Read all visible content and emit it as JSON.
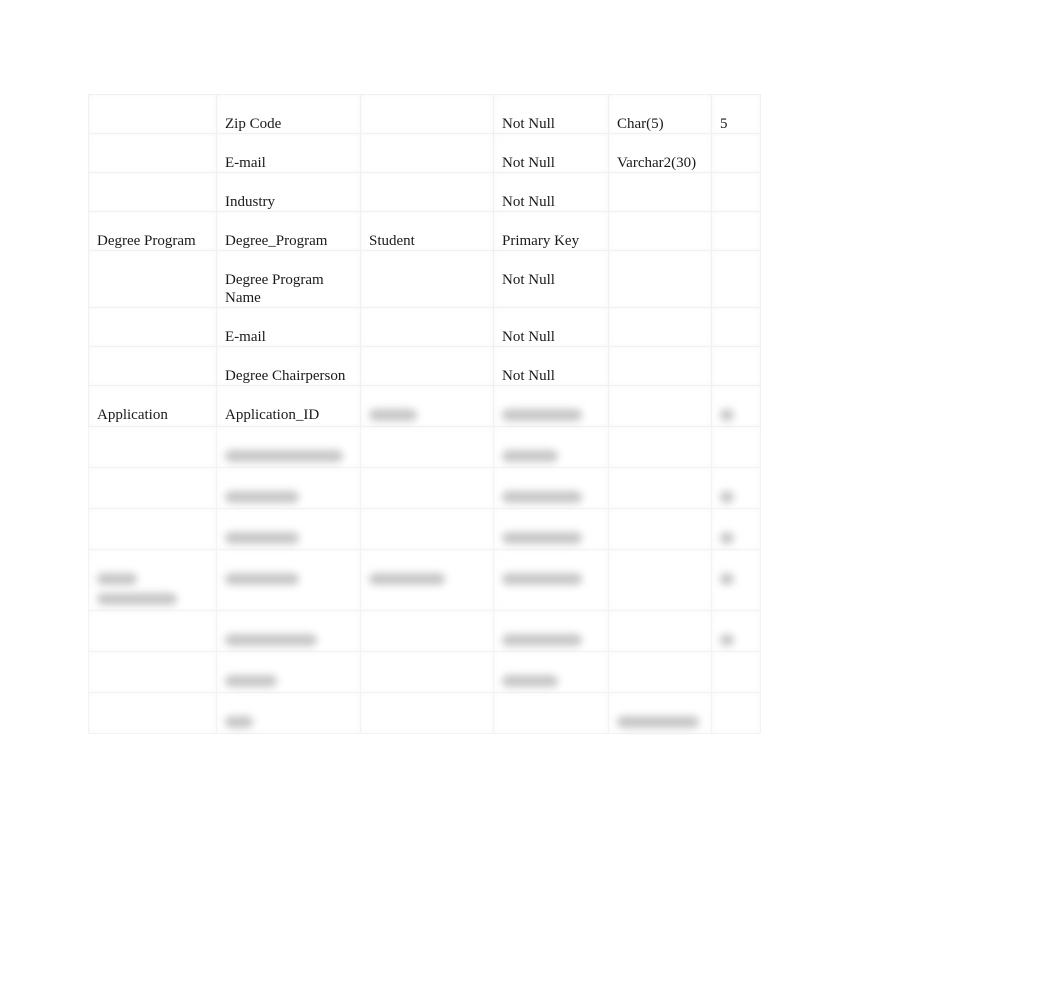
{
  "table": {
    "rows": [
      {
        "entity": "",
        "attribute": "Zip Code",
        "references": "",
        "constraint": "Not Null",
        "datatype": "Char(5)",
        "size": "5"
      },
      {
        "entity": "",
        "attribute": "E-mail",
        "references": "",
        "constraint": "Not Null",
        "datatype": "Varchar2(30)",
        "size": ""
      },
      {
        "entity": "",
        "attribute": "Industry",
        "references": "",
        "constraint": "Not Null",
        "datatype": "",
        "size": ""
      },
      {
        "entity": "Degree Program",
        "attribute": "Degree_Program",
        "references": "Student",
        "constraint": "Primary Key",
        "datatype": "",
        "size": ""
      },
      {
        "entity": "",
        "attribute": "Degree Program Name",
        "references": "",
        "constraint": "Not Null",
        "datatype": "",
        "size": ""
      },
      {
        "entity": "",
        "attribute": "E-mail",
        "references": "",
        "constraint": "Not Null",
        "datatype": "",
        "size": ""
      },
      {
        "entity": "",
        "attribute": "Degree Chairperson",
        "references": "",
        "constraint": "Not Null",
        "datatype": "",
        "size": ""
      },
      {
        "entity": "Application",
        "attribute": "Application_ID",
        "references": "",
        "constraint": "",
        "datatype": "",
        "size": ""
      }
    ],
    "blurred_rows_note": "remaining rows are blurred and unreadable"
  }
}
